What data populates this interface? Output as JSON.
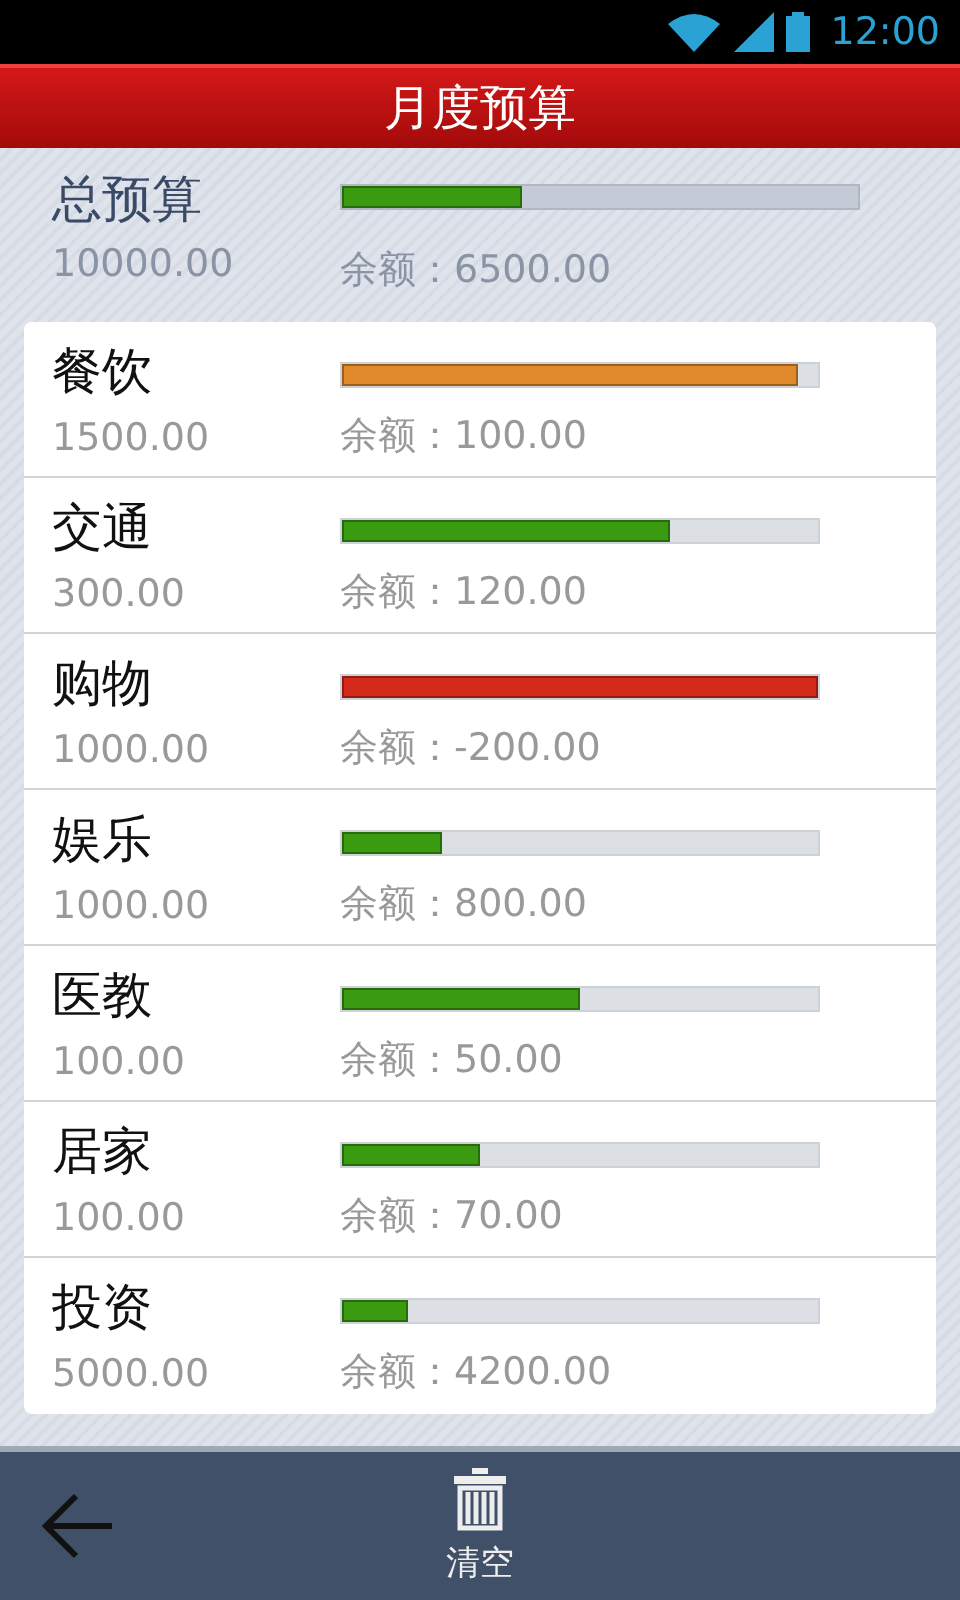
{
  "status_bar": {
    "time": "12:00"
  },
  "title": "月度预算",
  "total": {
    "label": "总预算",
    "amount": "10000.00",
    "remaining": "余额：6500.00",
    "level": 0.35
  },
  "categories": [
    {
      "name": "餐饮",
      "amount": "1500.00",
      "remaining": "余额：100.00",
      "level": 0.96,
      "color": "#e08a2c"
    },
    {
      "name": "交通",
      "amount": "300.00",
      "remaining": "余额：120.00",
      "level": 0.69,
      "color": "#3a9a10"
    },
    {
      "name": "购物",
      "amount": "1000.00",
      "remaining": "余额：-200.00",
      "level": 1.0,
      "color": "#d42a1c"
    },
    {
      "name": "娱乐",
      "amount": "1000.00",
      "remaining": "余额：800.00",
      "level": 0.21,
      "color": "#3a9a10"
    },
    {
      "name": "医教",
      "amount": "100.00",
      "remaining": "余额：50.00",
      "level": 0.5,
      "color": "#3a9a10"
    },
    {
      "name": "居家",
      "amount": "100.00",
      "remaining": "余额：70.00",
      "level": 0.29,
      "color": "#3a9a10"
    },
    {
      "name": "投资",
      "amount": "5000.00",
      "remaining": "余额：4200.00",
      "level": 0.14,
      "color": "#3a9a10"
    }
  ],
  "toolbar": {
    "clear_label": "清空"
  }
}
